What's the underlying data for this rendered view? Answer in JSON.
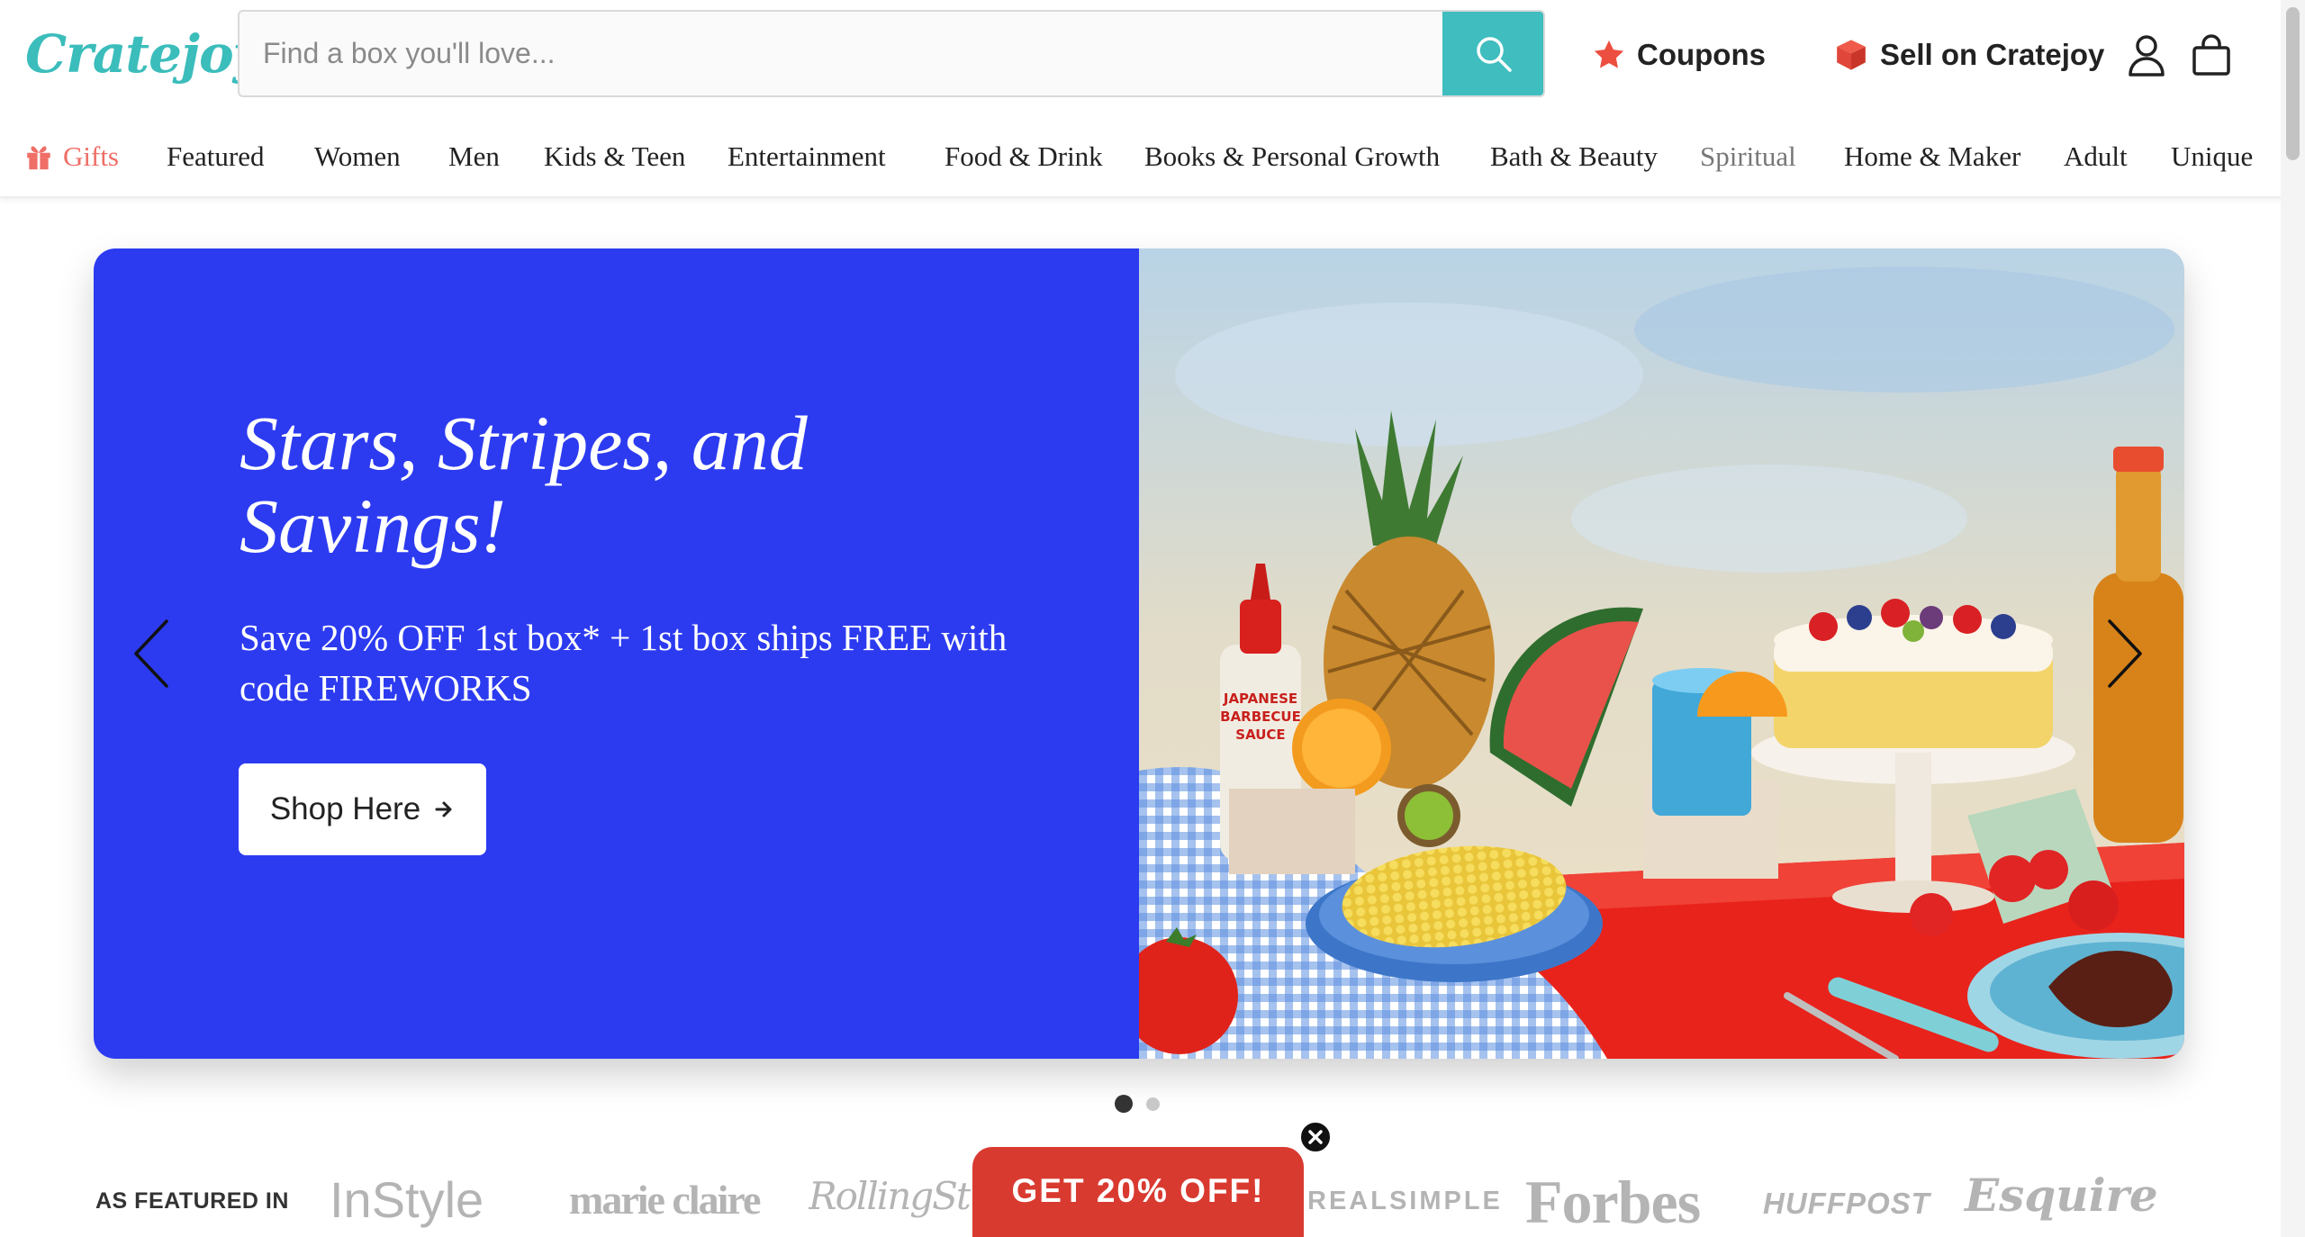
{
  "header": {
    "logo_text": "Cratejoy",
    "search_placeholder": "Find a box you'll love...",
    "coupons_label": "Coupons",
    "sell_label": "Sell on Cratejoy",
    "accent_color": "#3fbdbf"
  },
  "nav": {
    "items": [
      "Gifts",
      "Featured",
      "Women",
      "Men",
      "Kids & Teen",
      "Entertainment",
      "Food & Drink",
      "Books & Personal Growth",
      "Bath & Beauty",
      "Spiritual",
      "Home & Maker",
      "Adult",
      "Unique"
    ],
    "gifts_color": "#ef6e66"
  },
  "hero": {
    "title": "Stars, Stripes, and Savings!",
    "subtitle": "Save 20% OFF 1st box* + 1st box ships FREE with code FIREWORKS",
    "button_label": "Shop Here",
    "background_color": "#2c3bf0",
    "sauce_label_line1": "JAPANESE",
    "sauce_label_line2": "BARBECUE",
    "sauce_label_line3": "SAUCE"
  },
  "carousel": {
    "active_slide": 1,
    "slide_count": 2
  },
  "featured": {
    "label": "AS FEATURED IN",
    "logos": [
      "InStyle",
      "marie claire",
      "RollingStone",
      "REALSIMPLE",
      "Forbes",
      "HUFFPOST",
      "Esquire"
    ]
  },
  "promo": {
    "label": "GET 20% OFF!",
    "color": "#d93a30"
  }
}
